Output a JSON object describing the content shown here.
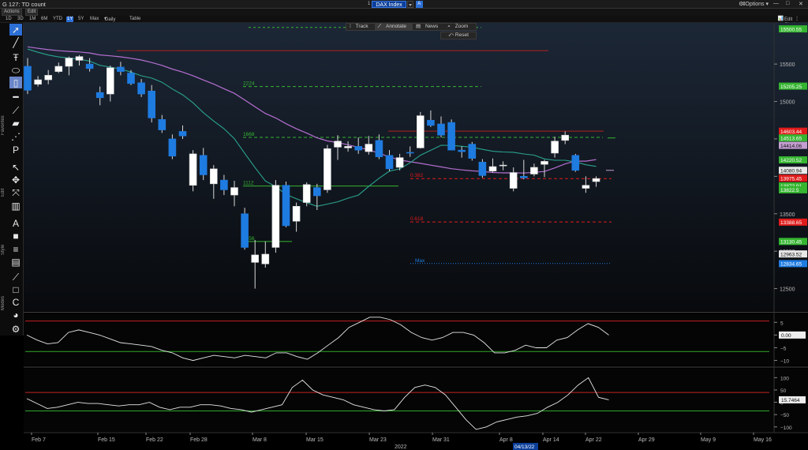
{
  "window": {
    "title": "G 127: TD count",
    "ticker_num": "1",
    "ticker": "DAX Index",
    "ticker_mode": "A",
    "options": "Options",
    "controls": [
      "⇕",
      "—",
      "□",
      "✕"
    ]
  },
  "menu": [
    "Actions",
    "Edit"
  ],
  "ranges": {
    "items": [
      "1D",
      "3D",
      "1M",
      "6M",
      "YTD",
      "1Y",
      "5Y",
      "Max",
      "Daily"
    ],
    "selected": "1Y",
    "table": "Table",
    "edit_chart": "Edit Chart"
  },
  "overlay": {
    "track": "Track",
    "annotate": "Annotate",
    "news": "News",
    "zoom": "Zoom",
    "reset": "Reset"
  },
  "toolbox": {
    "labels": {
      "favorites": "Favorites",
      "edit": "Edit",
      "style": "Style",
      "modes": "Modes"
    },
    "tools": [
      "cursor-icon",
      "line-icon",
      "text-icon",
      "ellipse-icon",
      "bracket-icon",
      "horizontal-line-icon",
      "trendline-icon",
      "channel-icon",
      "zigzag-icon",
      "fibonacci-icon",
      "arrow-icon",
      "move-icon",
      "crosshair-icon",
      "trash-icon",
      "text-style-icon",
      "fill-icon",
      "line-weight-icon",
      "grid-icon",
      "brush-icon",
      "square-icon",
      "snap-icon",
      "palette-icon",
      "gear-icon"
    ]
  },
  "chart_data": [
    {
      "type": "candlestick",
      "series_name": "DAX Index",
      "y_ticks": [
        15500,
        15000,
        14500,
        14000,
        13500,
        13000,
        12500
      ],
      "ylim": [
        12200,
        16050
      ],
      "price_tags": [
        {
          "label": "15500.55",
          "value": 15970,
          "color": "#35b530"
        },
        {
          "label": "15205.25",
          "value": 15205,
          "color": "#35b530"
        },
        {
          "label": "14603.44",
          "value": 14603,
          "color": "#e01b1b"
        },
        {
          "label": "14513.65",
          "value": 14513,
          "color": "#35b530"
        },
        {
          "label": "14414.06",
          "value": 14414,
          "color": "#c49ed1"
        },
        {
          "label": "14220.52",
          "value": 14220,
          "color": "#35b530"
        },
        {
          "label": "14080.94",
          "value": 14080,
          "color": "#e8e8e8"
        },
        {
          "label": "13975.45",
          "value": 13975,
          "color": "#e01b1b"
        },
        {
          "label": "13872.91",
          "value": 13872,
          "color": "#35b530"
        },
        {
          "label": "13822.5",
          "value": 13820,
          "color": "#35b530"
        },
        {
          "label": "13388.65",
          "value": 13388,
          "color": "#e01b1b"
        },
        {
          "label": "13130.45",
          "value": 13130,
          "color": "#35b530"
        },
        {
          "label": "12963.52",
          "value": 12963,
          "color": "#e8e8e8"
        },
        {
          "label": "12834.65",
          "value": 12834,
          "color": "#1e7be0"
        }
      ],
      "levels": [
        {
          "label": "2224",
          "value": 15200,
          "color": "#35b530",
          "style": "dashed"
        },
        {
          "label": "1668",
          "value": 14520,
          "color": "#35b530",
          "style": "dashed"
        },
        {
          "label": "1112",
          "value": 13870,
          "color": "#35b530",
          "style": "solid"
        },
        {
          "label": "0556",
          "value": 13130,
          "color": "#35b530",
          "style": "solid"
        },
        {
          "label": "0.382",
          "value": 13970,
          "color": "#e01b1b",
          "style": "dashed"
        },
        {
          "label": "0.618",
          "value": 13390,
          "color": "#e01b1b",
          "style": "dashed"
        },
        {
          "label": "Max",
          "value": 12835,
          "color": "#1e7be0",
          "style": "dotted"
        }
      ],
      "candles": [
        [
          15470,
          15580,
          15100,
          15150
        ],
        [
          15230,
          15340,
          15200,
          15290
        ],
        [
          15290,
          15420,
          15230,
          15350
        ],
        [
          15400,
          15520,
          15380,
          15470
        ],
        [
          15470,
          15600,
          15350,
          15580
        ],
        [
          15550,
          15620,
          15480,
          15600
        ],
        [
          15500,
          15580,
          15400,
          15440
        ],
        [
          15120,
          15200,
          14950,
          15050
        ],
        [
          15100,
          15480,
          15000,
          15450
        ],
        [
          15460,
          15530,
          15350,
          15400
        ],
        [
          15380,
          15420,
          15220,
          15240
        ],
        [
          15250,
          15300,
          15060,
          15100
        ],
        [
          15140,
          15220,
          14720,
          14780
        ],
        [
          14760,
          14820,
          14580,
          14620
        ],
        [
          14500,
          14560,
          14230,
          14270
        ],
        [
          14600,
          14680,
          14500,
          14540
        ],
        [
          13880,
          14350,
          13800,
          14300
        ],
        [
          14280,
          14380,
          13950,
          14020
        ],
        [
          13900,
          14150,
          13700,
          14100
        ],
        [
          13950,
          14020,
          13750,
          13820
        ],
        [
          13750,
          13940,
          13600,
          13850
        ],
        [
          13500,
          13580,
          13020,
          13050
        ],
        [
          12850,
          13150,
          12500,
          12950
        ],
        [
          12830,
          13130,
          12780,
          12960
        ],
        [
          13050,
          13950,
          12980,
          13880
        ],
        [
          13880,
          13930,
          13320,
          13340
        ],
        [
          13400,
          13650,
          13260,
          13600
        ],
        [
          13650,
          13920,
          13600,
          13890
        ],
        [
          13850,
          13900,
          13550,
          13740
        ],
        [
          13820,
          14420,
          13780,
          14370
        ],
        [
          14390,
          14550,
          14220,
          14470
        ],
        [
          14380,
          14470,
          14330,
          14400
        ],
        [
          14400,
          14520,
          14300,
          14350
        ],
        [
          14330,
          14540,
          14290,
          14430
        ],
        [
          14480,
          14560,
          14230,
          14260
        ],
        [
          14280,
          14350,
          14070,
          14100
        ],
        [
          14120,
          14300,
          14080,
          14250
        ],
        [
          14320,
          14400,
          14260,
          14310
        ],
        [
          14380,
          14860,
          14370,
          14810
        ],
        [
          14750,
          14880,
          14660,
          14680
        ],
        [
          14700,
          14800,
          14520,
          14550
        ],
        [
          14720,
          14760,
          14350,
          14350
        ],
        [
          14350,
          14400,
          14250,
          14330
        ],
        [
          14430,
          14460,
          14210,
          14240
        ],
        [
          14190,
          14230,
          13980,
          14010
        ],
        [
          14070,
          14240,
          14050,
          14130
        ],
        [
          14150,
          14200,
          14080,
          14150
        ],
        [
          13840,
          14120,
          13800,
          14050
        ],
        [
          14000,
          14220,
          13960,
          13980
        ],
        [
          14030,
          14170,
          14000,
          14120
        ],
        [
          14160,
          14220,
          13990,
          14200
        ],
        [
          14310,
          14530,
          14250,
          14470
        ],
        [
          14480,
          14600,
          14430,
          14550
        ],
        [
          14280,
          14300,
          14060,
          14080
        ],
        [
          13840,
          14000,
          13780,
          13880
        ],
        [
          13930,
          14000,
          13860,
          13970
        ]
      ],
      "x_labels": [
        "Feb 7",
        "Feb 15",
        "Feb 22",
        "Feb 28",
        "Mar 8",
        "Mar 15",
        "Mar 23",
        "Mar 31",
        "Apr 8",
        "Apr 14",
        "Apr 22",
        "Apr 29",
        "May 9",
        "May 16"
      ],
      "x_year": "2022",
      "cursor_date": "04/13/22"
    },
    {
      "type": "line",
      "y_ticks": [
        5,
        0,
        -5,
        -10
      ],
      "ylim": [
        -12,
        8.5
      ],
      "bands": [
        5.5,
        -6.5
      ],
      "current_label": "0.00",
      "values": [
        0,
        -2,
        -3.5,
        -3,
        1,
        2,
        1,
        0,
        -1.5,
        -3,
        -3.5,
        -4,
        -4.5,
        -6,
        -7,
        -9,
        -10,
        -9,
        -8,
        -8.5,
        -9,
        -8,
        -8.5,
        -9,
        -7,
        -7,
        -8.5,
        -9.5,
        -7,
        -4,
        -1,
        3,
        5,
        7,
        7,
        6,
        4,
        1,
        -1,
        -2,
        -1,
        1,
        1,
        0,
        -3,
        -7,
        -7,
        -6,
        -4,
        -5,
        -5,
        -2,
        -1,
        2,
        4.5,
        3,
        0
      ]
    },
    {
      "type": "line",
      "y_ticks": [
        100,
        50,
        0,
        -50,
        -100
      ],
      "ylim": [
        -120,
        130
      ],
      "bands": [
        40,
        -35
      ],
      "current_label": "15.7464",
      "values": [
        15,
        -5,
        -25,
        -20,
        -10,
        0,
        -5,
        -5,
        -10,
        -15,
        -10,
        -10,
        0,
        -20,
        -30,
        -20,
        -20,
        -10,
        -10,
        -15,
        -25,
        -30,
        -40,
        -30,
        -20,
        -10,
        60,
        90,
        50,
        30,
        20,
        10,
        -10,
        -20,
        -30,
        -35,
        -30,
        20,
        60,
        70,
        60,
        30,
        -20,
        -70,
        -110,
        -100,
        -80,
        -70,
        -60,
        -55,
        -45,
        -20,
        0,
        30,
        70,
        100,
        20,
        10
      ]
    }
  ]
}
